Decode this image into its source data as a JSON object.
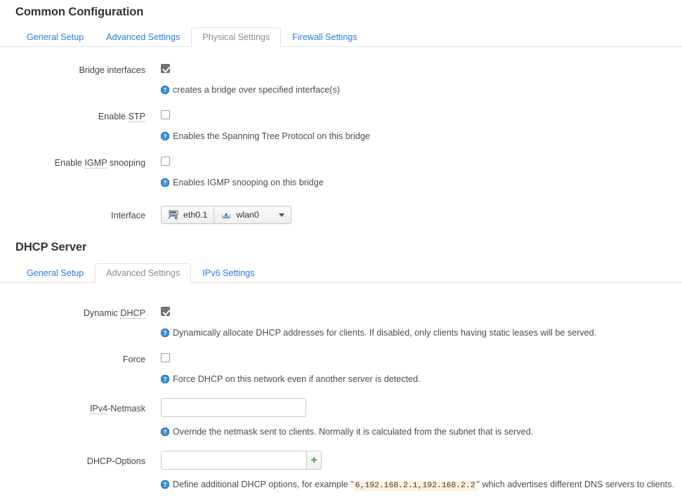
{
  "colors": {
    "tab_link": "#2a7ae2",
    "tab_active_text": "#8a8a8a",
    "help_icon": "#3c8fd4",
    "code_background": "#fdefdb",
    "add_button_plus": "#3ba33b",
    "checkbox_checked": "#737373"
  },
  "common_configuration": {
    "title": "Common Configuration",
    "tabs": [
      {
        "label": "General Setup",
        "active": false
      },
      {
        "label": "Advanced Settings",
        "active": false
      },
      {
        "label": "Physical Settings",
        "active": true
      },
      {
        "label": "Firewall Settings",
        "active": false
      }
    ],
    "fields": {
      "bridge_interfaces": {
        "label": "Bridge interfaces",
        "checked": true,
        "help": "creates a bridge over specified interface(s)"
      },
      "enable_stp": {
        "label_prefix": "Enable ",
        "label_abbr": "STP",
        "checked": false,
        "help": "Enables the Spanning Tree Protocol on this bridge"
      },
      "enable_igmp_snooping": {
        "label_prefix": "Enable ",
        "label_abbr": "IGMP",
        "label_suffix": " snooping",
        "checked": false,
        "help": "Enables IGMP snooping on this bridge"
      },
      "interface": {
        "label": "Interface",
        "segments": [
          {
            "name": "eth0.1",
            "icon": "ethernet-adapter-icon",
            "has_caret": false
          },
          {
            "name": "wlan0",
            "icon": "wireless-access-point-icon",
            "has_caret": true
          }
        ]
      }
    }
  },
  "dhcp_server": {
    "title": "DHCP Server",
    "tabs": [
      {
        "label": "General Setup",
        "active": false
      },
      {
        "label": "Advanced Settings",
        "active": true
      },
      {
        "label": "IPv6 Settings",
        "active": false
      }
    ],
    "fields": {
      "dynamic_dhcp": {
        "label_prefix": "Dynamic ",
        "label_abbr": "DHCP",
        "checked": true,
        "help": "Dynamically allocate DHCP addresses for clients. If disabled, only clients having static leases will be served."
      },
      "force": {
        "label": "Force",
        "checked": false,
        "help": "Force DHCP on this network even if another server is detected."
      },
      "ipv4_netmask": {
        "label_abbr": "IPv4",
        "label_suffix": "-Netmask",
        "value": "",
        "placeholder": "",
        "help": "Override the netmask sent to clients. Normally it is calculated from the subnet that is served."
      },
      "dhcp_options": {
        "label": "DHCP-Options",
        "value": "",
        "placeholder": "",
        "add_button_label": "+",
        "help_before": "Define additional DHCP options, for example \"",
        "help_code": "6,192.168.2.1,192.168.2.2",
        "help_after": "\" which advertises different DNS servers to clients."
      }
    }
  }
}
